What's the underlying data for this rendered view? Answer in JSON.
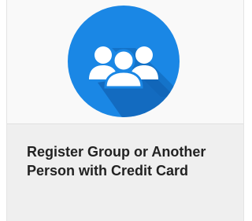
{
  "card": {
    "title": "Register Group or Another Person with Credit Card",
    "icon": "group-icon"
  },
  "colors": {
    "icon_background": "#1a87e5",
    "icon_shadow": "#1162b3",
    "icon_figures": "#ffffff",
    "card_top": "#f9f9f9",
    "card_bottom": "#efefef",
    "title_text": "#222222"
  }
}
